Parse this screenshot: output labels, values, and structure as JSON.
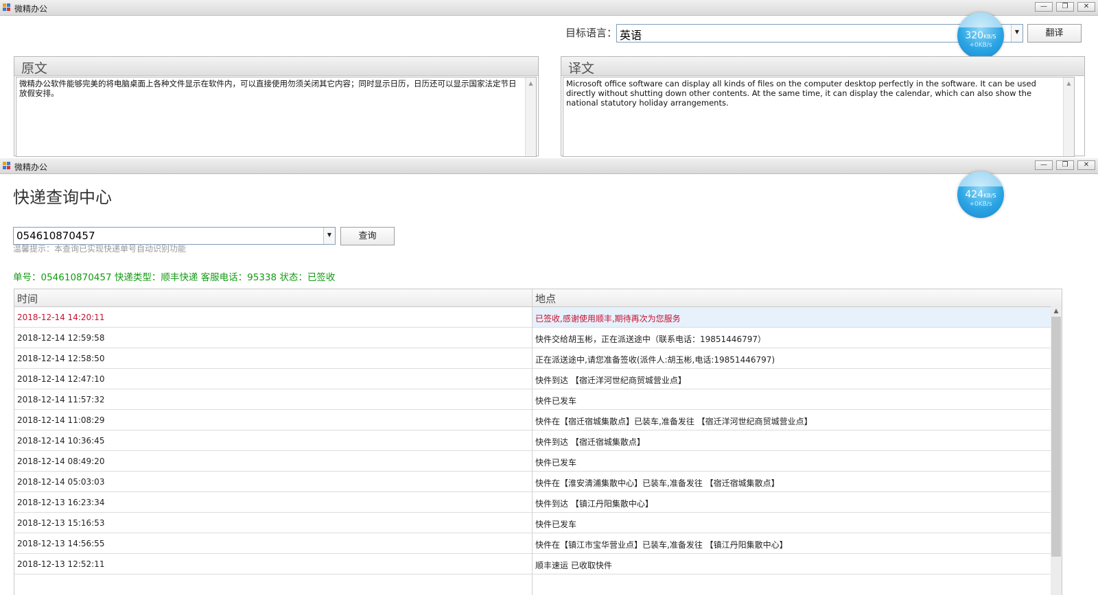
{
  "window1": {
    "title": "微精办公",
    "controls": {
      "minimize": "—",
      "restore": "❐",
      "close": "✕"
    },
    "speed": {
      "main": "320",
      "unit": "KB/S",
      "sub": "+0KB/s"
    },
    "target_lang_label": "目标语言：",
    "target_lang_value": "英语",
    "translate_button": "翻译",
    "source": {
      "heading": "原文",
      "text": "微精办公软件能够完美的将电脑桌面上各种文件显示在软件内，可以直接使用勿须关闭其它内容；同时显示日历，日历还可以显示国家法定节日放假安排。"
    },
    "target": {
      "heading": "译文",
      "text": "Microsoft office software can display all kinds of files on the computer desktop perfectly in the software. It can be used directly without shutting down other contents. At the same time, it can display the calendar, which can also show the national statutory holiday arrangements."
    }
  },
  "window2": {
    "title": "微精办公",
    "controls": {
      "minimize": "—",
      "restore": "❐",
      "close": "✕"
    },
    "speed": {
      "main": "424",
      "unit": "KB/S",
      "sub": "+0KB/s"
    },
    "page_title": "快递查询中心",
    "tracking_input": "054610870457",
    "query_button": "查询",
    "hint": "温馨提示：本查询已实现快递单号自动识别功能",
    "summary": "单号：054610870457  快递类型：顺丰快递  客服电话：95338  状态：已签收",
    "table": {
      "headers": [
        "时间",
        "地点"
      ],
      "rows": [
        {
          "time": "2018-12-14 14:20:11",
          "place": "已签收,感谢使用顺丰,期待再次为您服务"
        },
        {
          "time": "2018-12-14 12:59:58",
          "place": "快件交给胡玉彬，正在派送途中（联系电话：19851446797）"
        },
        {
          "time": "2018-12-14 12:58:50",
          "place": "正在派送途中,请您准备签收(派件人:胡玉彬,电话:19851446797)"
        },
        {
          "time": "2018-12-14 12:47:10",
          "place": "快件到达 【宿迁洋河世纪商贸城营业点】"
        },
        {
          "time": "2018-12-14 11:57:32",
          "place": "快件已发车"
        },
        {
          "time": "2018-12-14 11:08:29",
          "place": "快件在【宿迁宿城集散点】已装车,准备发往 【宿迁洋河世纪商贸城营业点】"
        },
        {
          "time": "2018-12-14 10:36:45",
          "place": "快件到达 【宿迁宿城集散点】"
        },
        {
          "time": "2018-12-14 08:49:20",
          "place": "快件已发车"
        },
        {
          "time": "2018-12-14 05:03:03",
          "place": "快件在【淮安清浦集散中心】已装车,准备发往 【宿迁宿城集散点】"
        },
        {
          "time": "2018-12-13 16:23:34",
          "place": "快件到达 【镇江丹阳集散中心】"
        },
        {
          "time": "2018-12-13 15:16:53",
          "place": "快件已发车"
        },
        {
          "time": "2018-12-13 14:56:55",
          "place": "快件在【镇江市宝华营业点】已装车,准备发往 【镇江丹阳集散中心】"
        },
        {
          "time": "2018-12-13 12:52:11",
          "place": "顺丰速运 已收取快件"
        }
      ]
    }
  },
  "colors": {
    "status_green": "#119a11",
    "latest_red": "#c8102e",
    "ball_blue": "#2ba5e4"
  }
}
